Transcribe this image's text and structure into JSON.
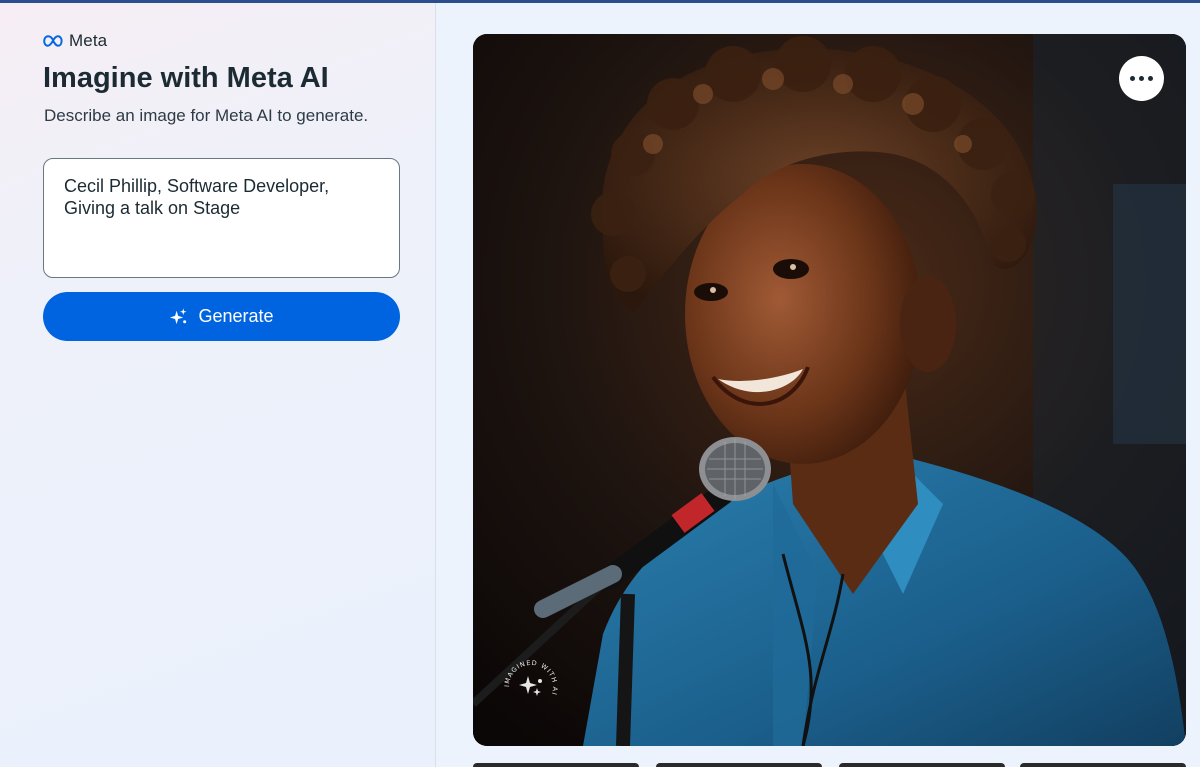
{
  "brand": {
    "name": "Meta",
    "logo_icon": "meta-infinity-icon",
    "logo_color": "#0668e1"
  },
  "header": {
    "title": "Imagine with Meta AI",
    "subtitle": "Describe an image for Meta AI to generate."
  },
  "prompt": {
    "value": "Cecil Phillip, Software Developer, Giving a talk on Stage"
  },
  "generate_button": {
    "label": "Generate",
    "icon": "sparkle-icon",
    "color": "#0064e0"
  },
  "image": {
    "alt": "AI generated image of a person speaking into a microphone on stage",
    "more_button_icon": "more-horizontal-icon",
    "watermark_text": "IMAGINED WITH AI"
  }
}
